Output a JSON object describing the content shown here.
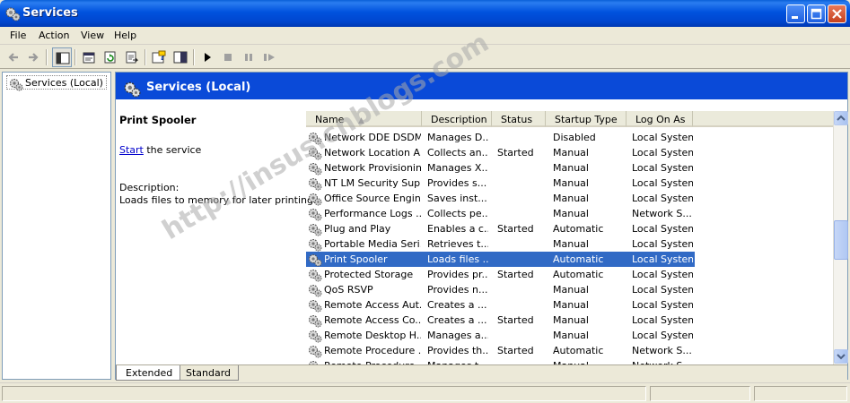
{
  "window": {
    "title": "Services"
  },
  "menu": [
    "File",
    "Action",
    "View",
    "Help"
  ],
  "tree": {
    "root_label": "Services (Local)"
  },
  "header": {
    "title": "Services (Local)"
  },
  "details": {
    "service_name": "Print Spooler",
    "start_link": "Start",
    "start_suffix": " the service",
    "description_label": "Description:",
    "description_text": "Loads files to memory for later printing."
  },
  "columns": [
    "Name",
    "Description",
    "Status",
    "Startup Type",
    "Log On As"
  ],
  "rows": [
    {
      "name": "Network DDE DSDM",
      "description": "Manages D...",
      "status": "",
      "startup": "Disabled",
      "logon": "Local System"
    },
    {
      "name": "Network Location A...",
      "description": "Collects an...",
      "status": "Started",
      "startup": "Manual",
      "logon": "Local System"
    },
    {
      "name": "Network Provisionin...",
      "description": "Manages X...",
      "status": "",
      "startup": "Manual",
      "logon": "Local System"
    },
    {
      "name": "NT LM Security Sup...",
      "description": "Provides s...",
      "status": "",
      "startup": "Manual",
      "logon": "Local System"
    },
    {
      "name": "Office Source Engine",
      "description": "Saves inst...",
      "status": "",
      "startup": "Manual",
      "logon": "Local System"
    },
    {
      "name": "Performance Logs ...",
      "description": "Collects pe...",
      "status": "",
      "startup": "Manual",
      "logon": "Network S..."
    },
    {
      "name": "Plug and Play",
      "description": "Enables a c...",
      "status": "Started",
      "startup": "Automatic",
      "logon": "Local System"
    },
    {
      "name": "Portable Media Seri...",
      "description": "Retrieves t...",
      "status": "",
      "startup": "Manual",
      "logon": "Local System"
    },
    {
      "name": "Print Spooler",
      "description": "Loads files ...",
      "status": "",
      "startup": "Automatic",
      "logon": "Local System",
      "selected": true
    },
    {
      "name": "Protected Storage",
      "description": "Provides pr...",
      "status": "Started",
      "startup": "Automatic",
      "logon": "Local System"
    },
    {
      "name": "QoS RSVP",
      "description": "Provides n...",
      "status": "",
      "startup": "Manual",
      "logon": "Local System"
    },
    {
      "name": "Remote Access Aut...",
      "description": "Creates a ...",
      "status": "",
      "startup": "Manual",
      "logon": "Local System"
    },
    {
      "name": "Remote Access Co...",
      "description": "Creates a ...",
      "status": "Started",
      "startup": "Manual",
      "logon": "Local System"
    },
    {
      "name": "Remote Desktop H...",
      "description": "Manages a...",
      "status": "",
      "startup": "Manual",
      "logon": "Local System"
    },
    {
      "name": "Remote Procedure ...",
      "description": "Provides th...",
      "status": "Started",
      "startup": "Automatic",
      "logon": "Network S..."
    },
    {
      "name": "Remote Procedure ...",
      "description": "Manages t...",
      "status": "",
      "startup": "Manual",
      "logon": "Network S..."
    }
  ],
  "tabs": [
    "Extended",
    "Standard"
  ],
  "watermark": "http://insus.cnblogs.com",
  "colors": {
    "title_bar": "#0052de",
    "header_band": "#0a4ad8",
    "selection": "#316ac5",
    "link": "#0000cc"
  }
}
